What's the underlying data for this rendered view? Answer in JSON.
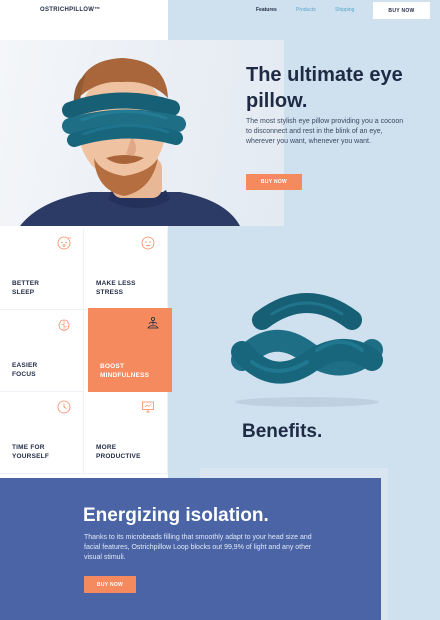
{
  "header": {
    "logo": "OSTRICHPILLOW™",
    "nav": [
      {
        "label": "Features",
        "active": true
      },
      {
        "label": "Products",
        "active": false
      },
      {
        "label": "Shipping",
        "active": false
      }
    ],
    "buy_label": "BUY NOW"
  },
  "hero": {
    "title": "The ultimate eye pillow.",
    "description": "The most stylish eye pillow providing you a cocoon to disconnect and rest in the blink of an eye, wherever you want, whenever you want.",
    "buy_label": "BUY NOW"
  },
  "benefits": {
    "title": "Benefits.",
    "items": [
      {
        "label": "BETTER SLEEP",
        "icon": "sleepy-face-icon"
      },
      {
        "label": "MAKE LESS STRESS",
        "icon": "calm-face-icon"
      },
      {
        "label": "EASIER FOCUS",
        "icon": "brain-icon"
      },
      {
        "label": "BOOST MINDFULNESS",
        "icon": "meditation-icon",
        "highlighted": true
      },
      {
        "label": "TIME FOR YOURSELF",
        "icon": "clock-icon"
      },
      {
        "label": "MORE PRODUCTIVE",
        "icon": "monitor-icon"
      }
    ]
  },
  "isolation": {
    "title": "Energizing isolation.",
    "description": "Thanks to its microbeads filling that smoothly adapt to your head size and facial features, Ostrichpillow Loop blocks out 99,9% of light and any other visual stimuli.",
    "buy_label": "BUY NOW"
  },
  "colors": {
    "accent": "#f58a5f",
    "navy": "#1f2a44",
    "panel_blue": "#4a64a6",
    "light_blue_bg": "#cfe0ee",
    "product_teal": "#1e6e85"
  }
}
